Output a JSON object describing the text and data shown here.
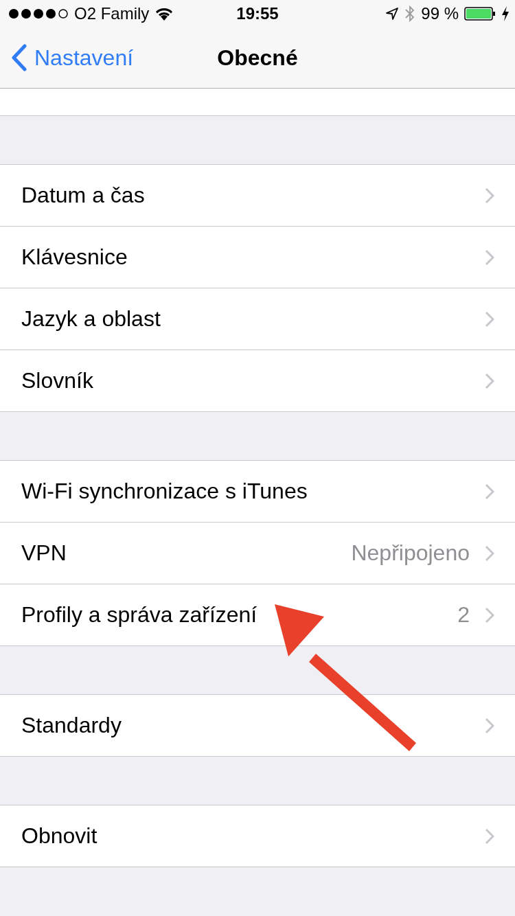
{
  "status_bar": {
    "carrier": "O2 Family",
    "time": "19:55",
    "battery": "99 %"
  },
  "nav_bar": {
    "back": "Nastavení",
    "title": "Obecné"
  },
  "groups": [
    {
      "rows": [
        {
          "label": "Datum a čas"
        },
        {
          "label": "Klávesnice"
        },
        {
          "label": "Jazyk a oblast"
        },
        {
          "label": "Slovník"
        }
      ]
    },
    {
      "rows": [
        {
          "label": "Wi-Fi synchronizace s iTunes"
        },
        {
          "label": "VPN",
          "value": "Nepřipojeno"
        },
        {
          "label": "Profily a správa zařízení",
          "value": "2"
        }
      ]
    },
    {
      "rows": [
        {
          "label": "Standardy"
        }
      ]
    },
    {
      "rows": [
        {
          "label": "Obnovit"
        }
      ]
    }
  ]
}
